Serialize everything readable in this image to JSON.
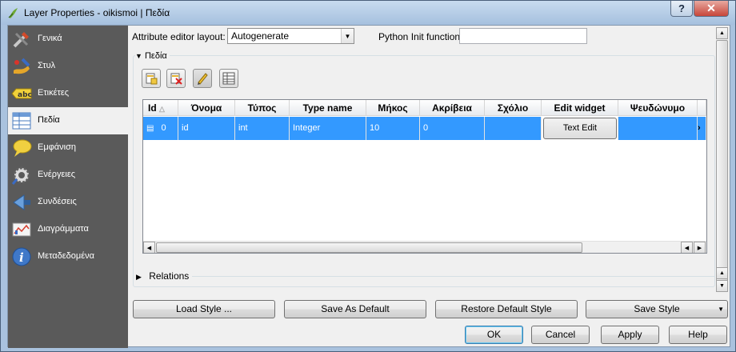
{
  "window": {
    "title": "Layer Properties - oikismoi | Πεδία"
  },
  "sidebar": {
    "items": [
      {
        "label": "Γενικά",
        "icon": "general-tools-icon"
      },
      {
        "label": "Στυλ",
        "icon": "style-brush-icon"
      },
      {
        "label": "Ετικέτες",
        "icon": "labels-abc-icon"
      },
      {
        "label": "Πεδία",
        "icon": "fields-table-icon",
        "active": true
      },
      {
        "label": "Εμφάνιση",
        "icon": "display-speech-icon"
      },
      {
        "label": "Ενέργειες",
        "icon": "actions-gear-icon"
      },
      {
        "label": "Συνδέσεις",
        "icon": "joins-icon"
      },
      {
        "label": "Διαγράμματα",
        "icon": "diagrams-icon"
      },
      {
        "label": "Μεταδεδομένα",
        "icon": "metadata-info-icon"
      }
    ]
  },
  "editor": {
    "layout_label": "Attribute editor layout:",
    "layout_value": "Autogenerate",
    "python_label": "Python Init function",
    "python_value": ""
  },
  "fields_group": {
    "title": "Πεδία"
  },
  "toolbar": {
    "icons": [
      "new-field-icon",
      "delete-field-icon",
      "edit-mode-pencil-icon",
      "field-calculator-icon"
    ]
  },
  "table": {
    "columns": [
      "Id",
      "Όνομα",
      "Τύπος",
      "Type name",
      "Μήκος",
      "Ακρίβεια",
      "Σχόλιο",
      "Edit widget",
      "Ψευδώνυμο"
    ],
    "rows": [
      {
        "id": "0",
        "name": "id",
        "type": "int",
        "type_name": "Integer",
        "length": "10",
        "precision": "0",
        "comment": "",
        "edit_widget": "Text Edit",
        "alias": ""
      }
    ]
  },
  "relations": {
    "title": "Relations"
  },
  "style_buttons": {
    "load": "Load Style ...",
    "save_default": "Save As Default",
    "restore_default": "Restore Default Style",
    "save": "Save Style"
  },
  "dialog_buttons": {
    "ok": "OK",
    "cancel": "Cancel",
    "apply": "Apply",
    "help": "Help"
  },
  "colors": {
    "selection": "#3399ff",
    "sidebar": "#5a5a5a",
    "titlebar": "#a9c2de"
  }
}
